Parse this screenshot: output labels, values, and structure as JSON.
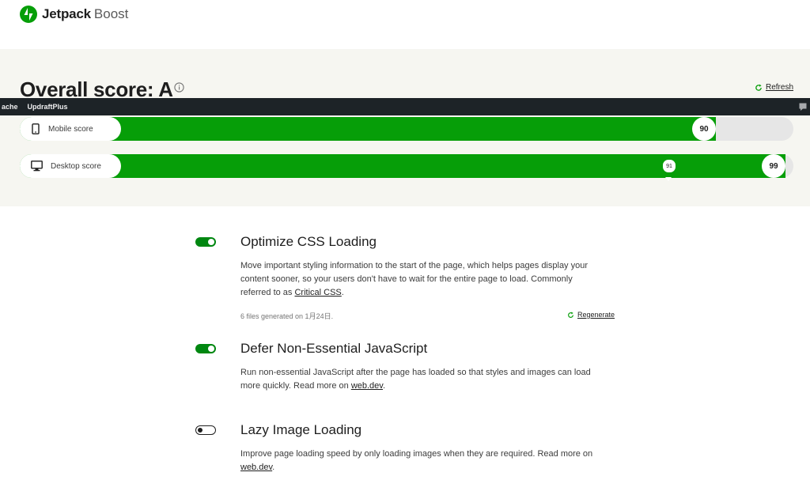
{
  "brand": {
    "name": "Jetpack",
    "product": "Boost"
  },
  "score": {
    "title": "Overall score: A",
    "refresh_label": "Refresh",
    "mobile": {
      "label": "Mobile score",
      "value": 90
    },
    "desktop": {
      "label": "Desktop score",
      "value": 99,
      "previous": 91
    }
  },
  "adminbar": {
    "items": [
      "ache",
      "UpdraftPlus"
    ]
  },
  "modules": [
    {
      "title": "Optimize CSS Loading",
      "enabled": true,
      "desc_1": "Move important styling information to the start of the page, which helps pages display your",
      "desc_2": "content sooner, so your users don't have to wait for the entire page to load. Commonly",
      "desc_3_prefix": "referred to as ",
      "desc_link": "Critical CSS",
      "desc_3_suffix": ".",
      "meta": "6 files generated on 1月24日.",
      "regenerate_label": "Regenerate"
    },
    {
      "title": "Defer Non-Essential JavaScript",
      "enabled": true,
      "desc_1": "Run non-essential JavaScript after the page has loaded so that styles and images can load",
      "desc_2_prefix": "more quickly. Read more on ",
      "desc_link": "web.dev",
      "desc_2_suffix": "."
    },
    {
      "title": "Lazy Image Loading",
      "enabled": false,
      "desc_1": "Improve page loading speed by only loading images when they are required. Read more on",
      "desc_link": "web.dev",
      "desc_2_suffix": "."
    }
  ],
  "colors": {
    "accent": "#069e08",
    "toggle_on": "#008710",
    "score_bg": "#f6f6f1"
  }
}
